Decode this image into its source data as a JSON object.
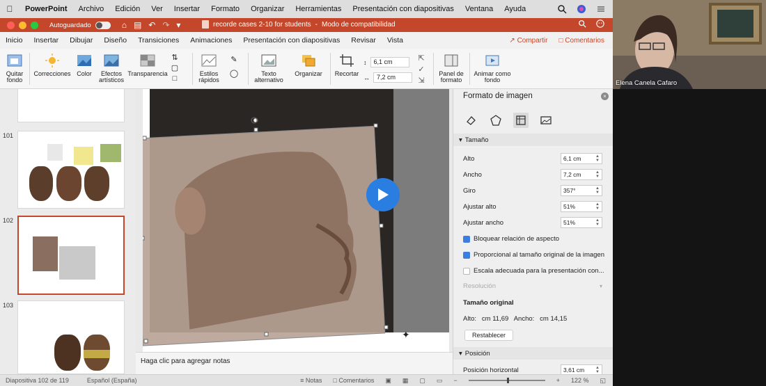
{
  "menubar": {
    "app": "PowerPoint",
    "items": [
      "Archivo",
      "Edición",
      "Ver",
      "Insertar",
      "Formato",
      "Organizar",
      "Herramientas",
      "Presentación con diapositivas",
      "Ventana",
      "Ayuda"
    ]
  },
  "titlebar": {
    "autosave_label": "Autoguardado",
    "doc_title": "recorde cases 2-10 for students",
    "mode": "Modo de compatibilidad"
  },
  "tabs": {
    "items": [
      "Inicio",
      "Insertar",
      "Dibujar",
      "Diseño",
      "Transiciones",
      "Animaciones",
      "Presentación con diapositivas",
      "Revisar",
      "Vista"
    ],
    "share": "Compartir",
    "comments": "Comentarios"
  },
  "ribbon": {
    "remove_bg": "Quitar fondo",
    "corrections": "Correcciones",
    "color": "Color",
    "art_effects": "Efectos artísticos",
    "transparency": "Transparencia",
    "quick_styles": "Estilos rápidos",
    "alt_text": "Texto alternativo",
    "arrange": "Organizar",
    "crop": "Recortar",
    "height": "6,1 cm",
    "width": "7,2 cm",
    "format_pane": "Panel de formato",
    "animate_bg": "Animar como fondo"
  },
  "thumbnails": {
    "numbers": [
      "101",
      "102",
      "103"
    ]
  },
  "canvas": {
    "notes_placeholder": "Haga clic para agregar notas"
  },
  "pane": {
    "title": "Formato de imagen",
    "section_size": "Tamaño",
    "height_label": "Alto",
    "height_value": "6,1 cm",
    "width_label": "Ancho",
    "width_value": "7,2 cm",
    "rotation_label": "Giro",
    "rotation_value": "357°",
    "scale_h_label": "Ajustar alto",
    "scale_h_value": "51%",
    "scale_w_label": "Ajustar ancho",
    "scale_w_value": "51%",
    "lock_aspect": "Bloquear relación de aspecto",
    "relative_original": "Proporcional al tamaño original de la imagen",
    "best_scale": "Escala adecuada para la presentación con...",
    "resolution_label": "Resolución",
    "original_size_title": "Tamaño original",
    "original_size_text": "Alto:   cm 11,69   Ancho:   cm 14,15",
    "reset": "Restablecer",
    "section_position": "Posición",
    "h_position_label": "Posición horizontal",
    "h_position_value": "3,61 cm"
  },
  "status": {
    "slide": "Diapositiva 102 de 119",
    "language": "Español (España)",
    "notes": "Notas",
    "comments": "Comentarios",
    "zoom": "122 %"
  },
  "webcam": {
    "name": "Elena Canela Cafaro"
  },
  "colors": {
    "accent": "#c4472b",
    "play": "#2a7de1",
    "checkbox": "#3b7ee0"
  }
}
